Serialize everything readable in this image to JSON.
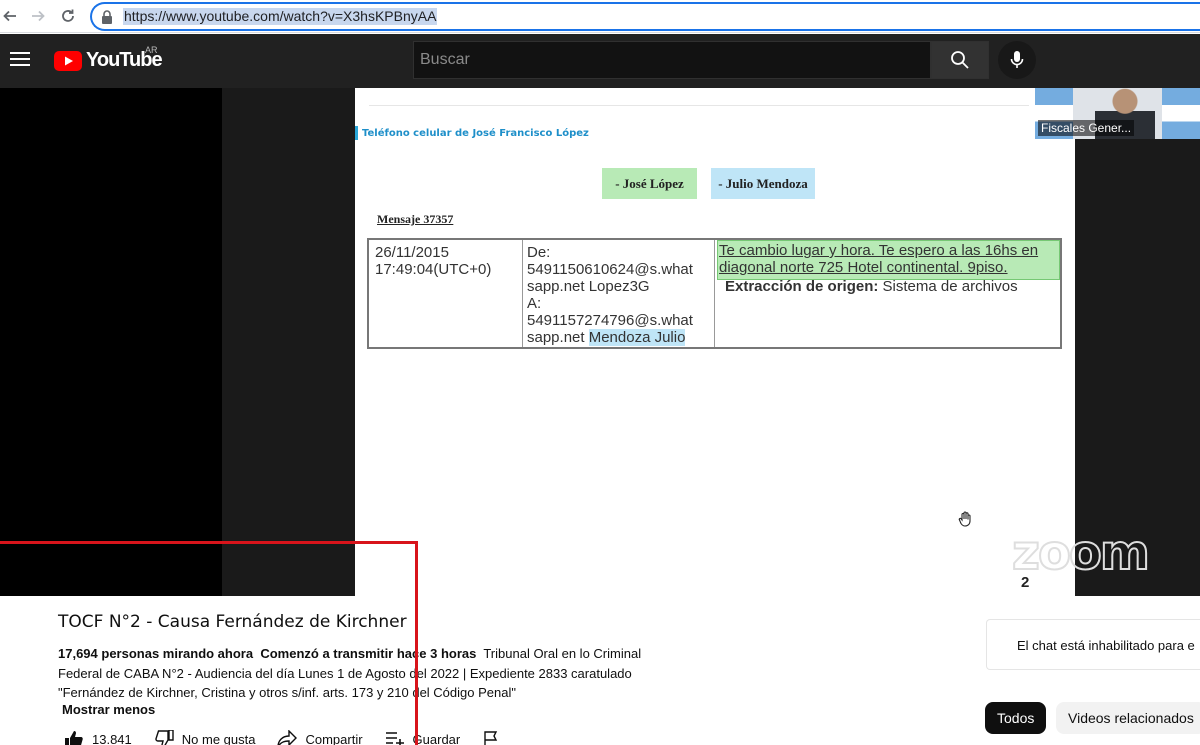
{
  "browser": {
    "url": "https://www.youtube.com/watch?v=X3hsKPBnyAA"
  },
  "header": {
    "logo_text": "YouTube",
    "country_code": "AR",
    "search_placeholder": "Buscar"
  },
  "player": {
    "document": {
      "heading": "Teléfono celular de José Francisco López",
      "parties": [
        "- José López",
        "- Julio Mendoza"
      ],
      "message_label": "Mensaje 37357",
      "message": {
        "date": "26/11/2015",
        "time": "17:49:04(UTC+0)",
        "from_label": "De:",
        "from_number": "5491150610624@s.what",
        "from_domain": "sapp.net Lopez3G",
        "to_label": "A:",
        "to_number": "5491157274796@s.what",
        "to_domain_prefix": "sapp.net ",
        "to_name": "Mendoza Julio",
        "body": "Te cambio lugar y hora. Te espero a las 16hs en diagonal norte 725 Hotel continental. 9piso.",
        "origin_label": "Extracción de origen:",
        "origin_value": " Sistema de archivos"
      },
      "page_number": "2"
    },
    "zoom_logo": "zoom",
    "webcam_label": "Fiscales Gener..."
  },
  "video": {
    "title": "TOCF N°2 - Causa Fernández de Kirchner",
    "viewers": "17,694 personas mirando ahora",
    "started": "Comenzó a transmitir hace 3 horas",
    "description": "Tribunal Oral en lo Criminal Federal de CABA N°2 - Audiencia del día Lunes 1 de Agosto del 2022 | Expediente 2833 caratulado \"Fernández de Kirchner, Cristina y otros s/inf. arts. 173 y 210 del Código Penal\"",
    "show_less": "Mostrar menos",
    "actions": {
      "like_count": "13.841",
      "dislike": "No me gusta",
      "share": "Compartir",
      "save": "Guardar"
    }
  },
  "sidebar": {
    "chat_status": "El chat está inhabilitado para e",
    "chips": [
      "Todos",
      "Videos relacionados"
    ]
  },
  "colors": {
    "youtube_red": "#ff0000",
    "annotation_red": "#d8141b",
    "highlight_green": "#b8eab6",
    "highlight_blue": "#bfe5f7"
  }
}
